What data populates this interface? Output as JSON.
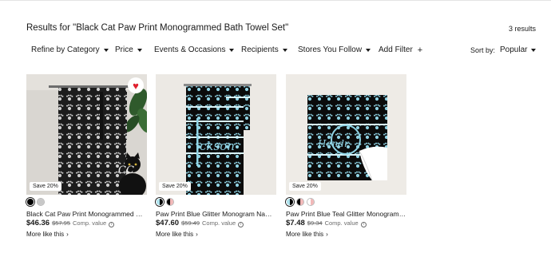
{
  "header": {
    "title": "Results for \"Black Cat Paw Print Monogrammed Bath Towel Set\"",
    "count": "3 results"
  },
  "filters": [
    {
      "label": "Refine by Category",
      "kind": "dropdown"
    },
    {
      "label": "Price",
      "kind": "dropdown"
    },
    {
      "label": "Events & Occasions",
      "kind": "dropdown"
    },
    {
      "label": "Recipients",
      "kind": "dropdown"
    },
    {
      "label": "Stores You Follow",
      "kind": "dropdown"
    },
    {
      "label": "Add Filter",
      "kind": "add"
    }
  ],
  "sort": {
    "label": "Sort by:",
    "value": "Popular"
  },
  "products": [
    {
      "title": "Black Cat Paw Print Monogrammed Bath Towel Set",
      "badge": "Save 20%",
      "favorited": true,
      "price": "$46.36",
      "old_price": "$57.95",
      "comp": "Comp. value",
      "more": "More like this",
      "swatches": [
        {
          "left": "#000000",
          "right": "#000000",
          "selected": true
        },
        {
          "left": "#c8c8c8",
          "right": "#c8c8c8",
          "selected": false
        }
      ]
    },
    {
      "title": "Paw Print Blue Glitter Monogram Name Custom Bath Towel Set",
      "badge": "Save 20%",
      "favorited": false,
      "price": "$47.60",
      "old_price": "$59.49",
      "comp": "Comp. value",
      "more": "More like this",
      "swatches": [
        {
          "left": "#aee3ee",
          "right": "#000000",
          "selected": true
        },
        {
          "left": "#000000",
          "right": "#f2b8b8",
          "selected": false
        }
      ]
    },
    {
      "title": "Paw Print Blue Teal Glitter Monogram Cat Name Towel",
      "badge": "Save 20%",
      "favorited": false,
      "price": "$7.48",
      "old_price": "$9.34",
      "comp": "Comp. value",
      "more": "More like this",
      "swatches": [
        {
          "left": "#aee3ee",
          "right": "#000000",
          "selected": true
        },
        {
          "left": "#000000",
          "right": "#f2b8b8",
          "selected": false
        },
        {
          "left": "#ffffff",
          "right": "#f2b8b8",
          "selected": false
        }
      ]
    }
  ],
  "image_text": {
    "p1_monogram": "CC",
    "p2_name": "ckson",
    "p3_name": "Hendr"
  }
}
